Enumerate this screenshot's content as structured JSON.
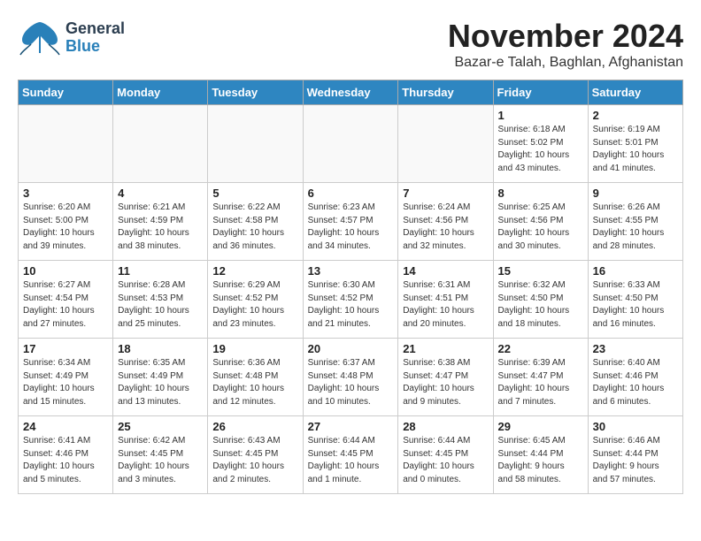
{
  "header": {
    "logo_general": "General",
    "logo_blue": "Blue",
    "month_title": "November 2024",
    "location": "Bazar-e Talah, Baghlan, Afghanistan"
  },
  "days_of_week": [
    "Sunday",
    "Monday",
    "Tuesday",
    "Wednesday",
    "Thursday",
    "Friday",
    "Saturday"
  ],
  "weeks": [
    [
      {
        "num": "",
        "info": ""
      },
      {
        "num": "",
        "info": ""
      },
      {
        "num": "",
        "info": ""
      },
      {
        "num": "",
        "info": ""
      },
      {
        "num": "",
        "info": ""
      },
      {
        "num": "1",
        "info": "Sunrise: 6:18 AM\nSunset: 5:02 PM\nDaylight: 10 hours\nand 43 minutes."
      },
      {
        "num": "2",
        "info": "Sunrise: 6:19 AM\nSunset: 5:01 PM\nDaylight: 10 hours\nand 41 minutes."
      }
    ],
    [
      {
        "num": "3",
        "info": "Sunrise: 6:20 AM\nSunset: 5:00 PM\nDaylight: 10 hours\nand 39 minutes."
      },
      {
        "num": "4",
        "info": "Sunrise: 6:21 AM\nSunset: 4:59 PM\nDaylight: 10 hours\nand 38 minutes."
      },
      {
        "num": "5",
        "info": "Sunrise: 6:22 AM\nSunset: 4:58 PM\nDaylight: 10 hours\nand 36 minutes."
      },
      {
        "num": "6",
        "info": "Sunrise: 6:23 AM\nSunset: 4:57 PM\nDaylight: 10 hours\nand 34 minutes."
      },
      {
        "num": "7",
        "info": "Sunrise: 6:24 AM\nSunset: 4:56 PM\nDaylight: 10 hours\nand 32 minutes."
      },
      {
        "num": "8",
        "info": "Sunrise: 6:25 AM\nSunset: 4:56 PM\nDaylight: 10 hours\nand 30 minutes."
      },
      {
        "num": "9",
        "info": "Sunrise: 6:26 AM\nSunset: 4:55 PM\nDaylight: 10 hours\nand 28 minutes."
      }
    ],
    [
      {
        "num": "10",
        "info": "Sunrise: 6:27 AM\nSunset: 4:54 PM\nDaylight: 10 hours\nand 27 minutes."
      },
      {
        "num": "11",
        "info": "Sunrise: 6:28 AM\nSunset: 4:53 PM\nDaylight: 10 hours\nand 25 minutes."
      },
      {
        "num": "12",
        "info": "Sunrise: 6:29 AM\nSunset: 4:52 PM\nDaylight: 10 hours\nand 23 minutes."
      },
      {
        "num": "13",
        "info": "Sunrise: 6:30 AM\nSunset: 4:52 PM\nDaylight: 10 hours\nand 21 minutes."
      },
      {
        "num": "14",
        "info": "Sunrise: 6:31 AM\nSunset: 4:51 PM\nDaylight: 10 hours\nand 20 minutes."
      },
      {
        "num": "15",
        "info": "Sunrise: 6:32 AM\nSunset: 4:50 PM\nDaylight: 10 hours\nand 18 minutes."
      },
      {
        "num": "16",
        "info": "Sunrise: 6:33 AM\nSunset: 4:50 PM\nDaylight: 10 hours\nand 16 minutes."
      }
    ],
    [
      {
        "num": "17",
        "info": "Sunrise: 6:34 AM\nSunset: 4:49 PM\nDaylight: 10 hours\nand 15 minutes."
      },
      {
        "num": "18",
        "info": "Sunrise: 6:35 AM\nSunset: 4:49 PM\nDaylight: 10 hours\nand 13 minutes."
      },
      {
        "num": "19",
        "info": "Sunrise: 6:36 AM\nSunset: 4:48 PM\nDaylight: 10 hours\nand 12 minutes."
      },
      {
        "num": "20",
        "info": "Sunrise: 6:37 AM\nSunset: 4:48 PM\nDaylight: 10 hours\nand 10 minutes."
      },
      {
        "num": "21",
        "info": "Sunrise: 6:38 AM\nSunset: 4:47 PM\nDaylight: 10 hours\nand 9 minutes."
      },
      {
        "num": "22",
        "info": "Sunrise: 6:39 AM\nSunset: 4:47 PM\nDaylight: 10 hours\nand 7 minutes."
      },
      {
        "num": "23",
        "info": "Sunrise: 6:40 AM\nSunset: 4:46 PM\nDaylight: 10 hours\nand 6 minutes."
      }
    ],
    [
      {
        "num": "24",
        "info": "Sunrise: 6:41 AM\nSunset: 4:46 PM\nDaylight: 10 hours\nand 5 minutes."
      },
      {
        "num": "25",
        "info": "Sunrise: 6:42 AM\nSunset: 4:45 PM\nDaylight: 10 hours\nand 3 minutes."
      },
      {
        "num": "26",
        "info": "Sunrise: 6:43 AM\nSunset: 4:45 PM\nDaylight: 10 hours\nand 2 minutes."
      },
      {
        "num": "27",
        "info": "Sunrise: 6:44 AM\nSunset: 4:45 PM\nDaylight: 10 hours\nand 1 minute."
      },
      {
        "num": "28",
        "info": "Sunrise: 6:44 AM\nSunset: 4:45 PM\nDaylight: 10 hours\nand 0 minutes."
      },
      {
        "num": "29",
        "info": "Sunrise: 6:45 AM\nSunset: 4:44 PM\nDaylight: 9 hours\nand 58 minutes."
      },
      {
        "num": "30",
        "info": "Sunrise: 6:46 AM\nSunset: 4:44 PM\nDaylight: 9 hours\nand 57 minutes."
      }
    ]
  ]
}
